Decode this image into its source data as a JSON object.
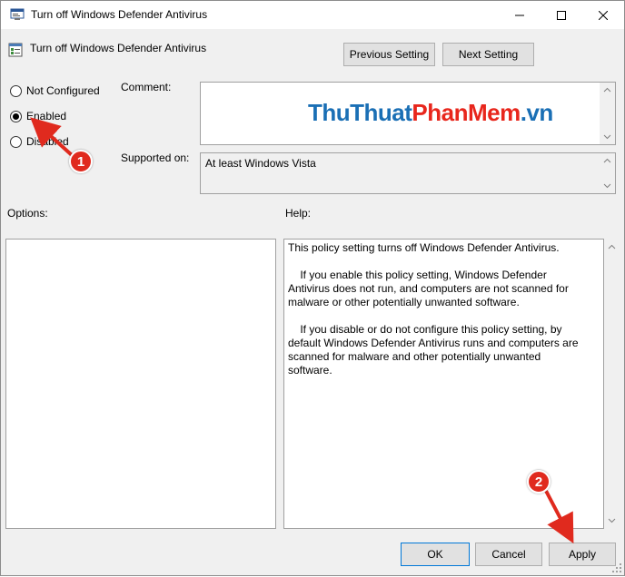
{
  "window": {
    "title": "Turn off Windows Defender Antivirus",
    "controls": {
      "minimize": "minimize",
      "maximize": "maximize",
      "close": "close"
    }
  },
  "header": {
    "title": "Turn off Windows Defender Antivirus",
    "previous_label": "Previous Setting",
    "next_label": "Next Setting"
  },
  "state": {
    "options": [
      {
        "label": "Not Configured",
        "checked": false
      },
      {
        "label": "Enabled",
        "checked": true
      },
      {
        "label": "Disabled",
        "checked": false
      }
    ]
  },
  "comment": {
    "label": "Comment:",
    "value": ""
  },
  "supported": {
    "label": "Supported on:",
    "value": "At least Windows Vista"
  },
  "options_label": "Options:",
  "help": {
    "label": "Help:",
    "paragraphs": [
      "This policy setting turns off Windows Defender Antivirus.",
      "    If you enable this policy setting, Windows Defender Antivirus does not run, and computers are not scanned for malware or other potentially unwanted software.",
      "    If you disable or do not configure this policy setting, by default Windows Defender Antivirus runs and computers are scanned for malware and other potentially unwanted software."
    ]
  },
  "footer": {
    "ok_label": "OK",
    "cancel_label": "Cancel",
    "apply_label": "Apply"
  },
  "watermark": {
    "part1": "ThuThuat",
    "part2": "PhanMem",
    "part3": ".vn"
  },
  "annotations": {
    "badge1": "1",
    "badge2": "2"
  },
  "colors": {
    "accent_red": "#e02a1e",
    "watermark_blue": "#1a6fb5",
    "watermark_red": "#e8261c"
  }
}
